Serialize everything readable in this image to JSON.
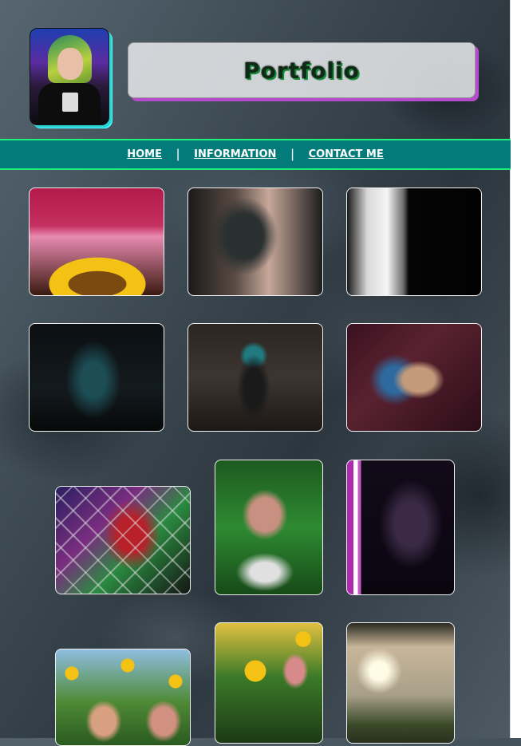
{
  "header": {
    "title": "Portfolio",
    "avatar_icon": "profile-photo"
  },
  "nav": {
    "items": [
      {
        "label": "HOME"
      },
      {
        "label": "INFORMATION"
      },
      {
        "label": "CONTACT ME"
      }
    ],
    "separator": "|"
  },
  "gallery": {
    "photos": [
      {
        "subject": "sunflower-portrait"
      },
      {
        "subject": "dark-room-portrait"
      },
      {
        "subject": "window-hand"
      },
      {
        "subject": "dark-teal-hair"
      },
      {
        "subject": "forest-figure"
      },
      {
        "subject": "string-lights-portrait"
      },
      {
        "subject": "chain-fence-makeup"
      },
      {
        "subject": "leaves-glasses-portrait"
      },
      {
        "subject": "light-saber-portrait"
      },
      {
        "subject": "sunflower-field-duo"
      },
      {
        "subject": "sunflower-field-laugh"
      },
      {
        "subject": "sunset-silhouette"
      }
    ]
  },
  "colors": {
    "nav_bg": "#047b7b",
    "nav_border": "#1ff07a",
    "title_shadow": "#b54ccb",
    "avatar_shadow": "#27d6d6",
    "title_text": "#0f2a16"
  }
}
